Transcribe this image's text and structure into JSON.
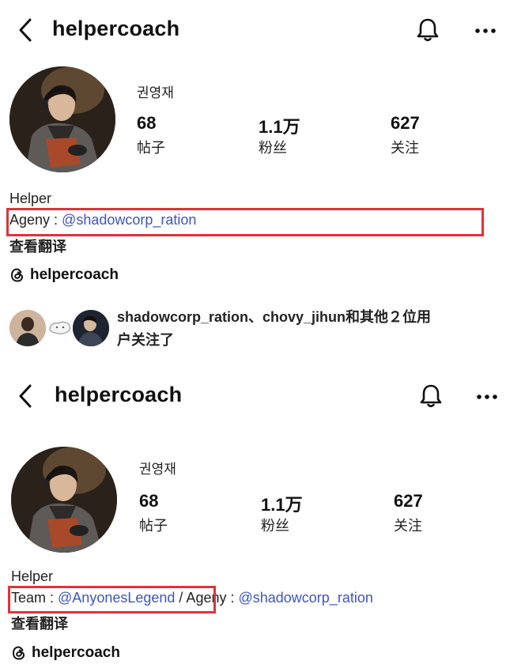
{
  "panels": [
    {
      "handle": "helpercoach",
      "real_name": "권영재",
      "stats": [
        {
          "value": "68",
          "label": "帖子"
        },
        {
          "value": "1.1万",
          "label": "粉丝"
        },
        {
          "value": "627",
          "label": "关注"
        }
      ],
      "bio_title": "Helper",
      "bio_line": {
        "prefix": "Ageny : ",
        "mention": "@shadowcorp_ration"
      },
      "translate": "查看翻译",
      "threads": "helpercoach",
      "followed_by": {
        "line1": "shadowcorp_ration、chovy_jihun和其他２位用",
        "line2": "户关注了"
      }
    },
    {
      "handle": "helpercoach",
      "real_name": "권영재",
      "stats": [
        {
          "value": "68",
          "label": "帖子"
        },
        {
          "value": "1.1万",
          "label": "粉丝"
        },
        {
          "value": "627",
          "label": "关注"
        }
      ],
      "bio_title": "Helper",
      "bio_line": {
        "prefix": "Team : ",
        "mention": "@AnyonesLegend",
        "sep": " / Ageny : ",
        "mention2": "@shadowcorp_ration"
      },
      "translate": "查看翻译",
      "threads": "helpercoach"
    }
  ],
  "icons": {
    "back": "chevron-left-icon",
    "bell": "bell-icon",
    "more": "more-horizontal-icon",
    "threads": "threads-icon"
  },
  "colors": {
    "mention": "#3b55c9",
    "highlight": "#e0323a"
  }
}
